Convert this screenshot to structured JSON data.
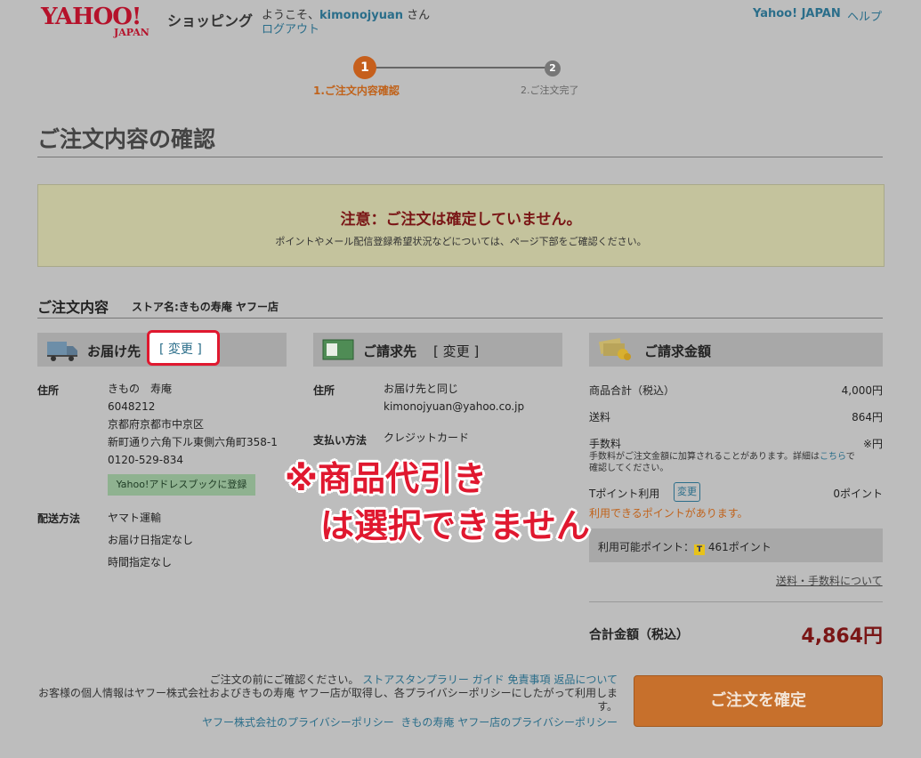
{
  "header": {
    "logo_main": "YAHOO!",
    "logo_sub": "JAPAN",
    "shop_name": "ショッピング",
    "welcome_prefix": "ようこそ、",
    "username": "kimonojyuan",
    "welcome_suffix": " さん",
    "logout": "ログアウト",
    "yahoo_japan": "Yahoo! JAPAN",
    "help": "ヘルプ"
  },
  "steps": [
    {
      "number": "1",
      "label": "1.ご注文内容確認"
    },
    {
      "number": "2",
      "label": "2.ご注文完了"
    }
  ],
  "page_title": "ご注文内容の確認",
  "notice": {
    "title": "注意：ご注文は確定していません。",
    "body": "ポイントやメール配信登録希望状況などについては、ページ下部をご確認ください。"
  },
  "section": {
    "title": "ご注文内容",
    "store_name": "ストア名:きもの寿庵 ヤフー店"
  },
  "delivery": {
    "title": "お届け先",
    "change": "[ 変更 ]",
    "address_label": "住所",
    "address_lines": [
      "きもの　寿庵",
      "6048212",
      "京都府京都市中京区",
      "新町通り六角下ル東側六角町358-1",
      "0120-529-834"
    ],
    "address_book_button": "Yahoo!アドレスブックに登録",
    "method_label": "配送方法",
    "method_lines": [
      "ヤマト運輸",
      "お届け日指定なし",
      "時間指定なし"
    ]
  },
  "billing_address": {
    "title": "ご請求先",
    "change": "[ 変更 ]",
    "address_label": "住所",
    "address_lines": [
      "お届け先と同じ",
      "kimonojyuan@yahoo.co.jp"
    ],
    "payment_label": "支払い方法",
    "payment_value": "クレジットカード"
  },
  "billing": {
    "title": "ご請求金額",
    "subtotal_label": "商品合計（税込）",
    "subtotal_value": "4,000円",
    "shipping_label": "送料",
    "shipping_value": "864円",
    "fee_label": "手数料",
    "fee_value": "※円",
    "fee_note_1": "手数料がご注文金額に加算されることがあります。詳細は",
    "fee_note_link": "こちら",
    "fee_note_2": "で",
    "fee_note_3": "確認してください。",
    "tpoint_label": "Tポイント利用",
    "tpoint_change": "変更",
    "tpoint_value": "0ポイント",
    "available_note": "利用できるポイントがあります。",
    "available_points_label": "利用可能ポイント：",
    "available_points_value": "461ポイント",
    "fee_link": "送料・手数料について",
    "total_label": "合計金額（税込）",
    "total_value": "4,864円"
  },
  "footer": {
    "line1_prefix": "ご注文の前にご確認ください。",
    "line1_links": [
      "ストアスタンプラリー ガイド",
      "免責事項",
      "返品について"
    ],
    "line2": "お客様の個人情報はヤフー株式会社およびきもの寿庵 ヤフー店が取得し、各プライバシーポリシーにしたがって利用しま",
    "line2b": "す。",
    "line3_links": [
      "ヤフー株式会社のプライバシーポリシー",
      "きもの寿庵 ヤフー店のプライバシーポリシー"
    ],
    "confirm_button": "ご注文を確定"
  },
  "annotation": {
    "line1": "※商品代引き",
    "line2": "は選択できません"
  },
  "colors": {
    "accent_orange": "#c65f1c",
    "highlight_red": "#e0182f",
    "notice_red": "#7a1616",
    "link_teal": "#2b6e8a"
  }
}
